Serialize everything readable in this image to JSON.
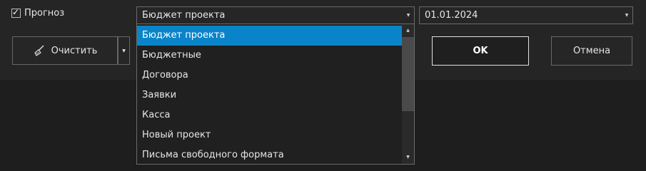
{
  "forecast": {
    "label": "Прогноз",
    "checked": true
  },
  "source_combo": {
    "value": "Бюджет проекта"
  },
  "date_combo": {
    "value": "01.01.2024"
  },
  "clear_button": {
    "label": "Очистить",
    "icon": "broom-icon"
  },
  "ok_button": {
    "label": "OK"
  },
  "cancel_button": {
    "label": "Отмена"
  },
  "dropdown": {
    "items": [
      {
        "label": "Бюджет проекта",
        "selected": true
      },
      {
        "label": "Бюджетные"
      },
      {
        "label": "Договора"
      },
      {
        "label": "Заявки"
      },
      {
        "label": "Касса"
      },
      {
        "label": "Новый проект"
      },
      {
        "label": "Письма свободного формата"
      }
    ]
  },
  "colors": {
    "selection": "#0a84c9",
    "background": "#252526",
    "border": "#6a6a6a"
  }
}
